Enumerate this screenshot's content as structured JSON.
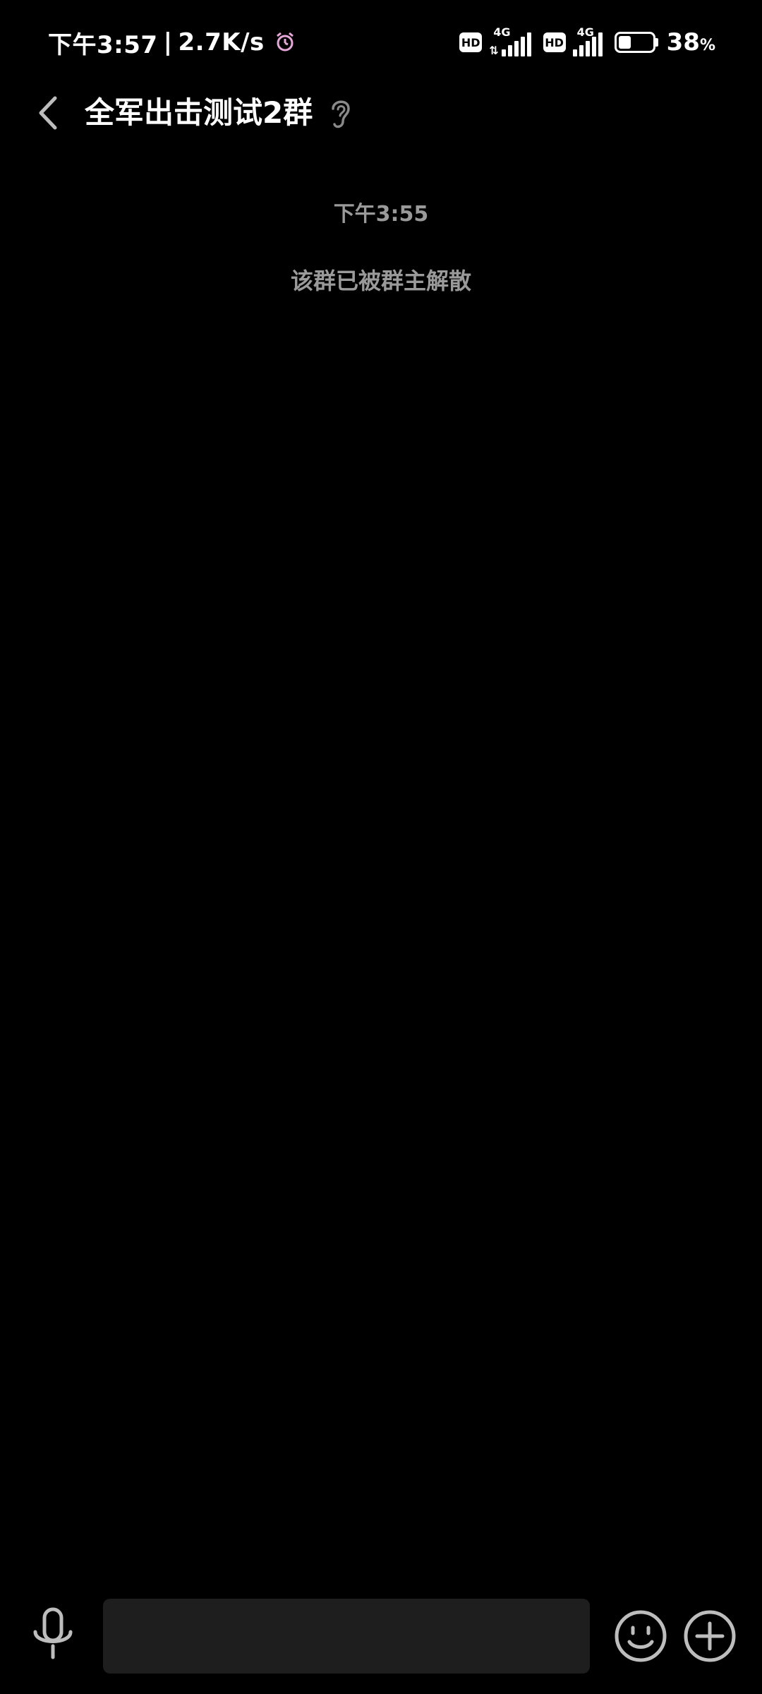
{
  "status_bar": {
    "time": "下午3:57",
    "separator": "|",
    "speed": "2.7K/s",
    "hd1": "HD",
    "net1": "4G",
    "arrows": "⇅",
    "hd2": "HD",
    "net2": "4G",
    "battery_level": 0.38,
    "battery_pct": "38",
    "battery_unit": "%"
  },
  "header": {
    "title": "全军出击测试2群"
  },
  "messages": {
    "time_label": "下午3:55",
    "system_message": "该群已被群主解散"
  },
  "input_bar": {
    "placeholder": ""
  },
  "colors": {
    "background": "#000000",
    "secondary_text": "#9a9a9a",
    "input_bg": "#1e1e1e",
    "icon_gray": "#bdbdbd"
  },
  "icons": {
    "back": "chevron-left-icon",
    "ear": "ear-icon",
    "voice": "microphone-icon",
    "emoji": "smiley-icon",
    "plus": "plus-circle-icon"
  }
}
